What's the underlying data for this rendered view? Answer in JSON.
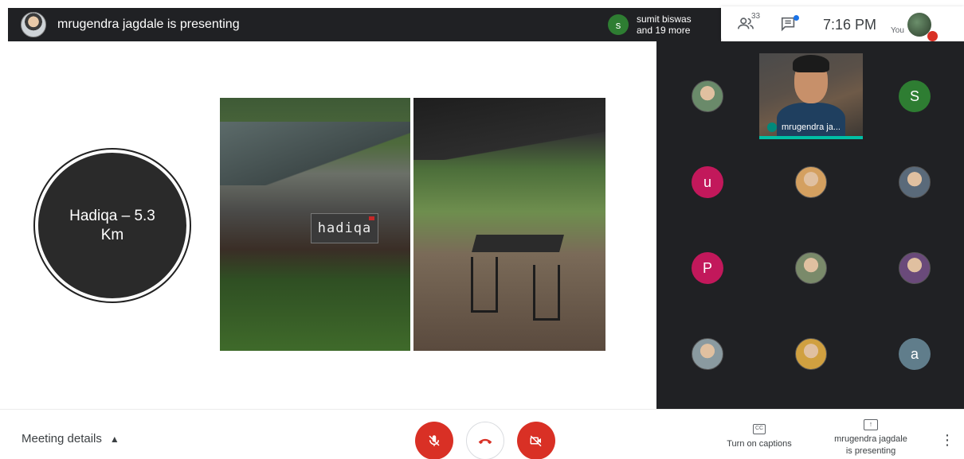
{
  "top_bar": {
    "presenting_text": "mrugendra jagdale is presenting",
    "participants_chip": {
      "initial": "s",
      "line1": "sumit biswas",
      "line2": "and 19 more"
    }
  },
  "top_right": {
    "people_count": "33",
    "time": "7:16 PM",
    "you_label": "You"
  },
  "slide": {
    "circle_text": "Hadiqa – 5.3 Km",
    "sign_text": "hadiqa"
  },
  "participants_panel": {
    "presenter_name": "mrugendra ja...",
    "tiles": [
      {
        "initial": "",
        "color": "#6a8a6a"
      },
      {
        "initial": "S",
        "color": "#2e7d32"
      },
      {
        "initial": "u",
        "color": "#c2185b"
      },
      {
        "initial": "",
        "color": "#d4a060"
      },
      {
        "initial": "",
        "color": "#5a6a7a"
      },
      {
        "initial": "P",
        "color": "#c2185b"
      },
      {
        "initial": "",
        "color": "#7a8a6a"
      },
      {
        "initial": "",
        "color": "#6a4a7a"
      },
      {
        "initial": "",
        "color": "#8a9aa0"
      },
      {
        "initial": "",
        "color": "#d0a040"
      },
      {
        "initial": "a",
        "color": "#607d8b"
      }
    ]
  },
  "bottom_bar": {
    "meeting_details": "Meeting details",
    "captions_label": "Turn on captions",
    "presenting_line1": "mrugendra jagdale",
    "presenting_line2": "is presenting"
  },
  "icons": {
    "cc": "CC",
    "present": "↑"
  }
}
